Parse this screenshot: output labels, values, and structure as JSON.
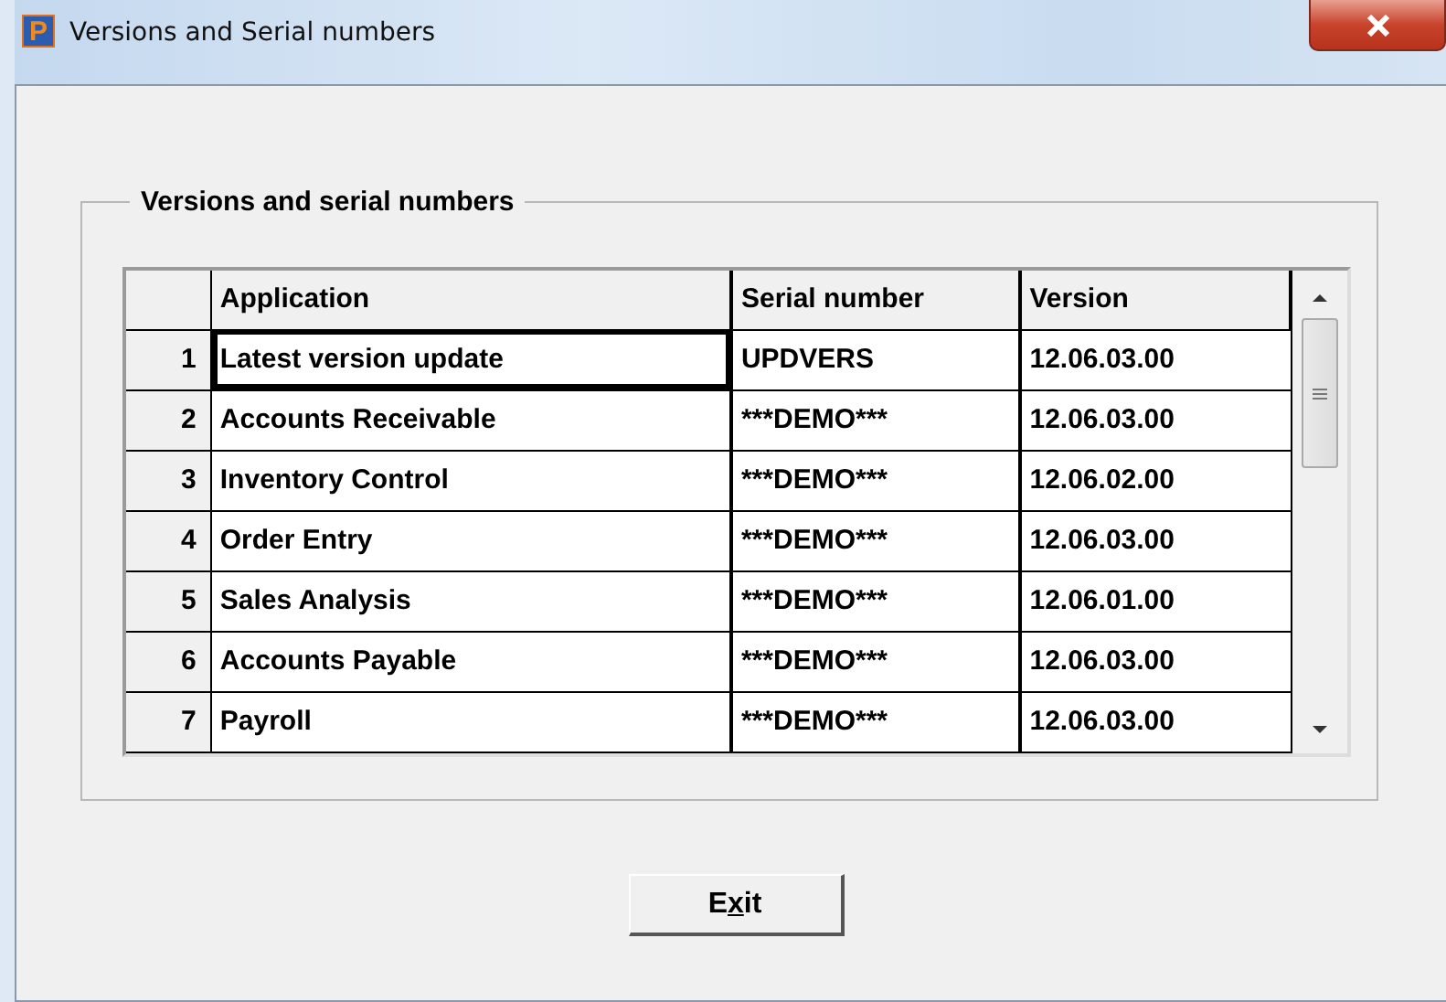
{
  "window": {
    "icon_letter": "P",
    "title": "Versions and Serial numbers"
  },
  "group": {
    "title": "Versions and serial numbers"
  },
  "table": {
    "columns": [
      "Application",
      "Serial number",
      "Version"
    ],
    "rows": [
      {
        "number": "1",
        "application": "Latest version update",
        "serial": "UPDVERS",
        "version": "12.06.03.00",
        "selected": true
      },
      {
        "number": "2",
        "application": "Accounts Receivable",
        "serial": "***DEMO***",
        "version": "12.06.03.00",
        "selected": false
      },
      {
        "number": "3",
        "application": "Inventory Control",
        "serial": "***DEMO***",
        "version": "12.06.02.00",
        "selected": false
      },
      {
        "number": "4",
        "application": "Order Entry",
        "serial": "***DEMO***",
        "version": "12.06.03.00",
        "selected": false
      },
      {
        "number": "5",
        "application": "Sales Analysis",
        "serial": "***DEMO***",
        "version": "12.06.01.00",
        "selected": false
      },
      {
        "number": "6",
        "application": "Accounts Payable",
        "serial": "***DEMO***",
        "version": "12.06.03.00",
        "selected": false
      },
      {
        "number": "7",
        "application": "Payroll",
        "serial": "***DEMO***",
        "version": "12.06.03.00",
        "selected": false
      }
    ]
  },
  "exit_button": {
    "label_before": "E",
    "access_key": "x",
    "label_after": "it"
  }
}
